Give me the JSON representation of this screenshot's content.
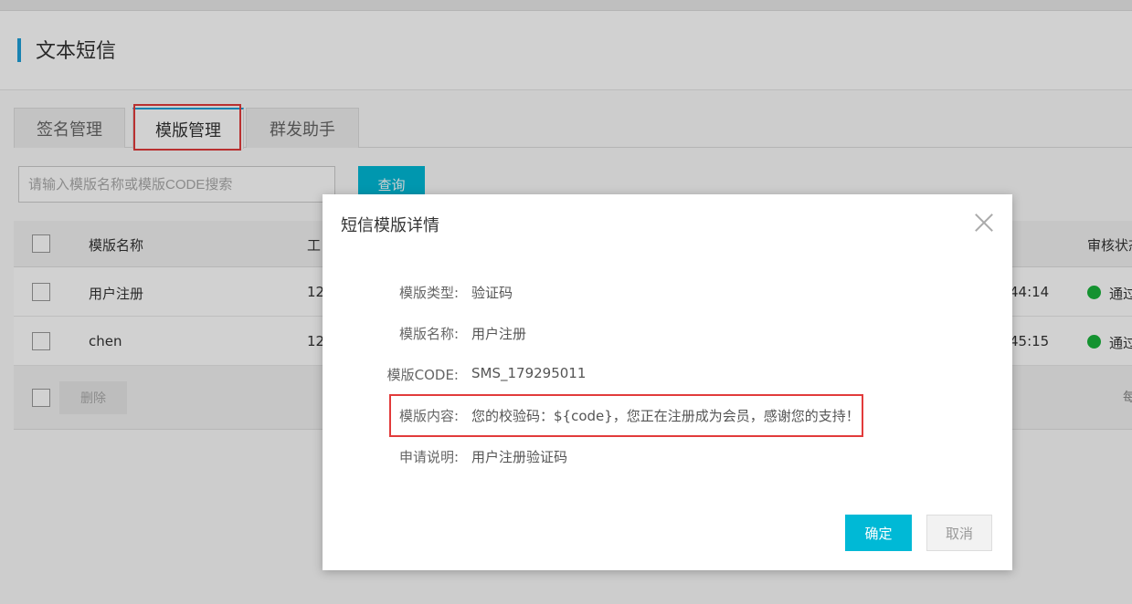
{
  "header": {
    "title": "文本短信"
  },
  "tabs": [
    {
      "label": "签名管理"
    },
    {
      "label": "模版管理"
    },
    {
      "label": "群发助手"
    }
  ],
  "search": {
    "placeholder": "请输入模版名称或模版CODE搜索",
    "button_label": "查询"
  },
  "table": {
    "columns": {
      "name": "模版名称",
      "code_partial": "工",
      "status_partial": "审核状态"
    },
    "rows": [
      {
        "name": "用户注册",
        "code_partial": "12",
        "time_partial": "44:14",
        "status_partial": "通过"
      },
      {
        "name": "chen",
        "code_partial": "12",
        "time_partial": "45:15",
        "status_partial": "通过"
      }
    ],
    "footer": {
      "delete_label": "删除",
      "right_partial": "每"
    }
  },
  "modal": {
    "title": "短信模版详情",
    "fields": [
      {
        "label": "模版类型:",
        "value": "验证码"
      },
      {
        "label": "模版名称:",
        "value": "用户注册"
      },
      {
        "label": "模版CODE:",
        "value": "SMS_179295011"
      },
      {
        "label": "模版内容:",
        "value": "您的校验码：${code}，您正在注册成为会员，感谢您的支持！"
      },
      {
        "label": "申请说明:",
        "value": "用户注册验证码"
      }
    ],
    "ok_label": "确定",
    "cancel_label": "取消"
  },
  "colors": {
    "accent": "#00b9d6",
    "highlight": "#e23b3b",
    "status_ok": "#19b23b"
  }
}
